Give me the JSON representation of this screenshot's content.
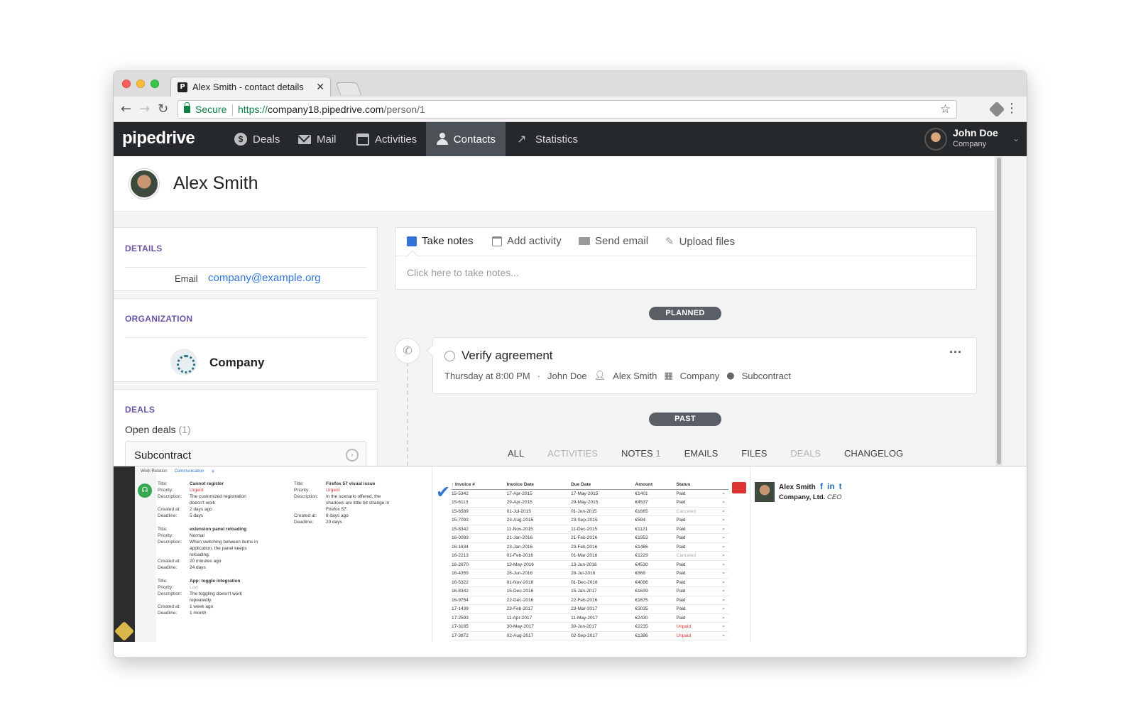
{
  "browser": {
    "tab_title": "Alex Smith - contact details",
    "tab_favicon": "P",
    "secure_label": "Secure",
    "url_scheme": "https://",
    "url_host": "company18.pipedrive.com",
    "url_path": "/person/1"
  },
  "app": {
    "logo": "pipedrive",
    "nav": [
      {
        "label": "Deals",
        "icon": "dollar-icon"
      },
      {
        "label": "Mail",
        "icon": "mail-icon"
      },
      {
        "label": "Activities",
        "icon": "calendar-icon"
      },
      {
        "label": "Contacts",
        "icon": "user-icon",
        "active": true
      },
      {
        "label": "Statistics",
        "icon": "trend-icon"
      }
    ],
    "user": {
      "name": "John Doe",
      "company": "Company"
    }
  },
  "person": {
    "name": "Alex Smith"
  },
  "details": {
    "title": "DETAILS",
    "email_label": "Email",
    "email": "company@example.org"
  },
  "organization": {
    "title": "ORGANIZATION",
    "name": "Company"
  },
  "deals": {
    "title": "DEALS",
    "open_label": "Open deals",
    "open_count": "(1)",
    "deal_name": "Subcontract"
  },
  "notes": {
    "tabs": [
      "Take notes",
      "Add activity",
      "Send email",
      "Upload files"
    ],
    "placeholder": "Click here to take notes..."
  },
  "timeline": {
    "planned_label": "PLANNED",
    "past_label": "PAST",
    "activity": {
      "title": "Verify agreement",
      "when": "Thursday at 8:00 PM",
      "sep": "·",
      "owner": "John Doe",
      "person": "Alex Smith",
      "org": "Company",
      "deal": "Subcontract"
    },
    "history_tabs": {
      "all": "ALL",
      "activities": "ACTIVITIES",
      "notes": "NOTES",
      "notes_count": "1",
      "emails": "EMAILS",
      "files": "FILES",
      "deals": "DEALS",
      "changelog": "CHANGELOG"
    }
  },
  "extension": {
    "tabs": [
      "Work Relation",
      "Communication"
    ],
    "tickets_left": [
      {
        "title": "Cannot register",
        "priority": "Urgent",
        "description": "The customized registration doesn't work",
        "created": "2 days ago",
        "deadline": "5 days"
      },
      {
        "title": "extension panel reloading",
        "priority": "Normal",
        "description": "When switching between items in application, the panel keeps reloading.",
        "created": "20 minutes ago",
        "deadline": "24 days"
      },
      {
        "title": "App: toggle integration",
        "priority": "Low",
        "description": "The toggling doesn't work repeatedly.",
        "created": "1 week ago",
        "deadline": "1 month"
      }
    ],
    "tickets_right": [
      {
        "title": "Firefox 57 visual issue",
        "priority": "Urgent",
        "description": "In the scenario offered, the shadows are little bit strange in Firefox 57.",
        "created": "8 days ago",
        "deadline": "20 days"
      }
    ],
    "labels": {
      "title": "Title:",
      "priority": "Priority:",
      "description": "Description:",
      "created": "Created at:",
      "deadline": "Deadline:"
    },
    "invoice_headers": [
      "↑ Invoice #",
      "Invoice Date",
      "Due Date",
      "Amount",
      "Status"
    ],
    "invoices": [
      [
        "15-5342",
        "17-Apr-2015",
        "17-May-2015",
        "€1401",
        "Paid"
      ],
      [
        "15-6113",
        "29-Apr-2015",
        "29-May-2015",
        "€4537",
        "Paid"
      ],
      [
        "15-6589",
        "01-Jul-2015",
        "01-Jun-2015",
        "€1665",
        "Canceled"
      ],
      [
        "15-7093",
        "23-Aug-2015",
        "23-Sep-2015",
        "€594",
        "Paid"
      ],
      [
        "15-8342",
        "11-Nov-2015",
        "11-Dec-2015",
        "€1121",
        "Paid"
      ],
      [
        "16-0083",
        "21-Jan-2016",
        "21-Feb-2016",
        "€1953",
        "Paid"
      ],
      [
        "16-1834",
        "23-Jan-2016",
        "23-Feb-2016",
        "€1486",
        "Paid"
      ],
      [
        "16-2213",
        "01-Feb-2016",
        "01-Mar-2016",
        "€1229",
        "Canceled"
      ],
      [
        "16-2870",
        "13-May-2016",
        "13-Jun-2016",
        "€4530",
        "Paid"
      ],
      [
        "16-4359",
        "28-Jun-2016",
        "28-Jul-2016",
        "€868",
        "Paid"
      ],
      [
        "16-5322",
        "01-Nov-2016",
        "01-Dec-2016",
        "€4096",
        "Paid"
      ],
      [
        "16-8342",
        "15-Dec-2016",
        "15-Jan-2017",
        "€1639",
        "Paid"
      ],
      [
        "16-9754",
        "22-Dec-2016",
        "22-Feb-2016",
        "€1675",
        "Paid"
      ],
      [
        "17-1439",
        "23-Feb-2017",
        "23-Mar-2017",
        "€3035",
        "Paid"
      ],
      [
        "17-2593",
        "11-Apr-2017",
        "11-May-2017",
        "€2430",
        "Paid"
      ],
      [
        "17-3165",
        "30-May-2017",
        "30-Jun-2017",
        "€2235",
        "Unpaid"
      ],
      [
        "17-3872",
        "02-Aug-2017",
        "02-Sep-2017",
        "€1386",
        "Unpaid"
      ]
    ],
    "contact": {
      "name": "Alex Smith",
      "company": "Company, Ltd.",
      "role": "CEO",
      "social": [
        "f",
        "in",
        "t"
      ]
    }
  }
}
